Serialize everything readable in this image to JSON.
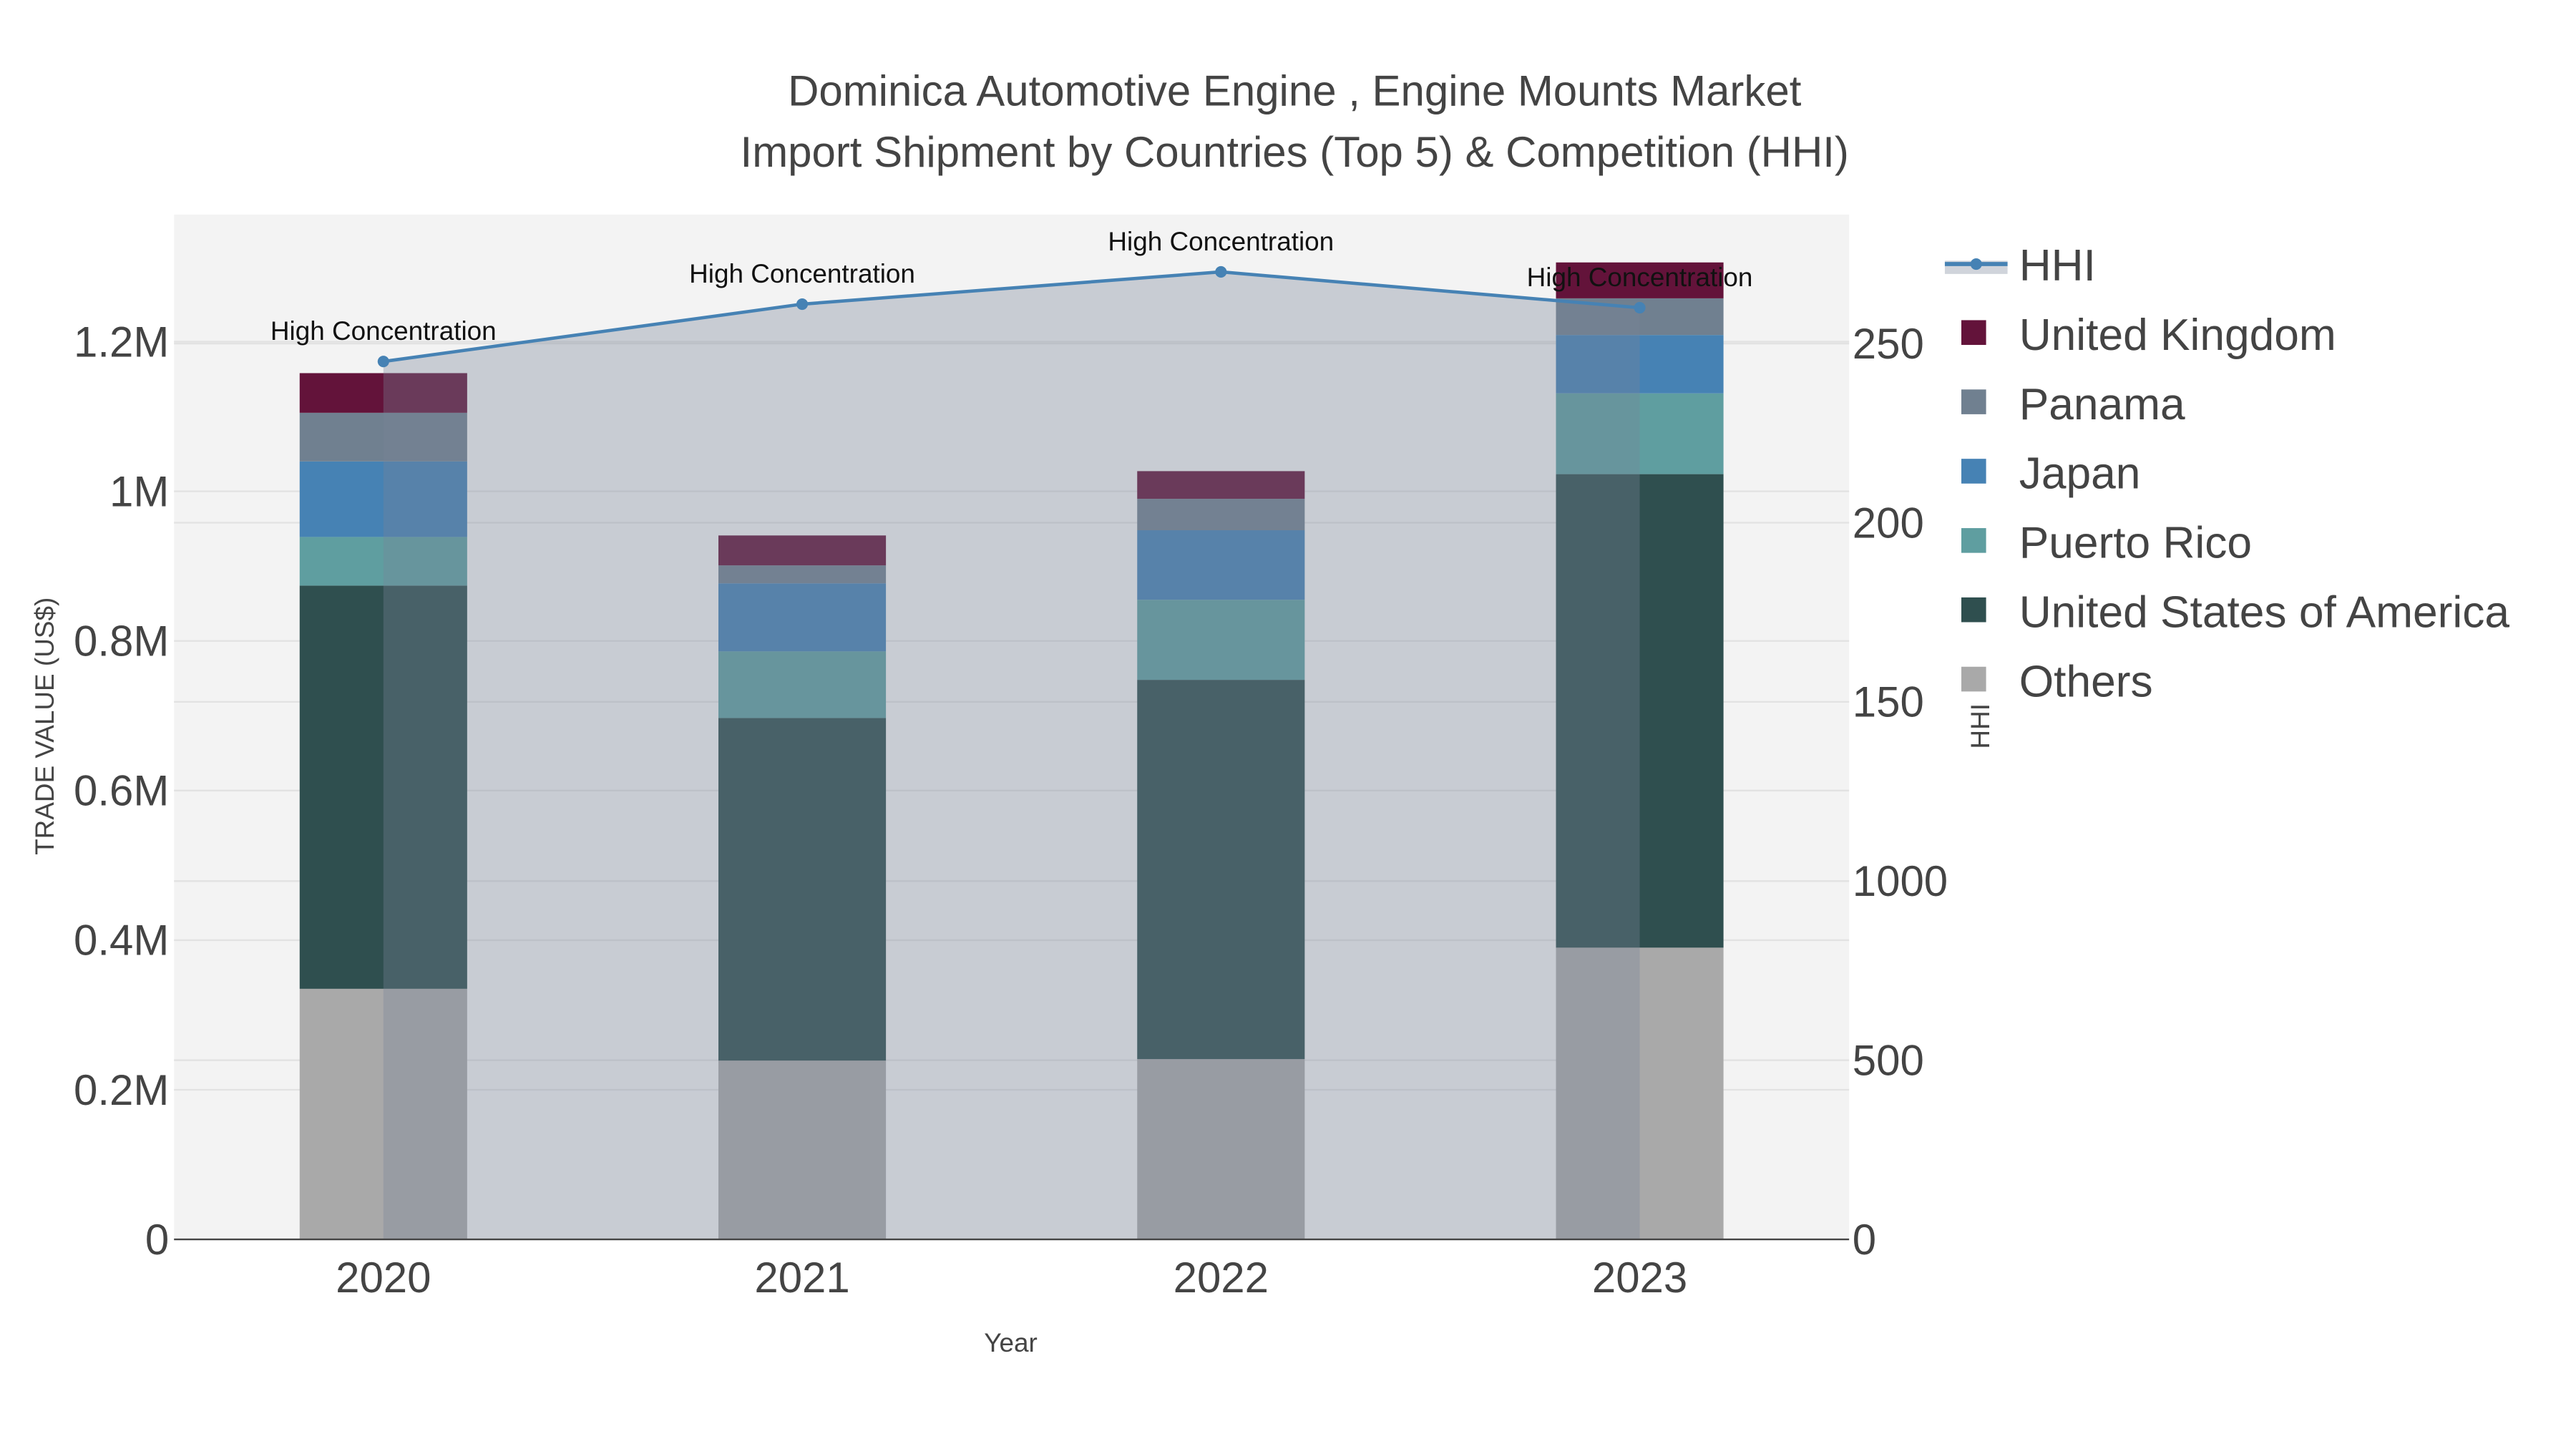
{
  "chart_data": {
    "type": "bar",
    "stacked": true,
    "title": "Dominica Automotive Engine , Engine Mounts Market",
    "subtitle": "Import Shipment by Countries (Top 5) & Competition (HHI)",
    "xlabel": "Year",
    "ylabel": "TRADE VALUE (US$)",
    "y2label": "HHI",
    "categories": [
      "2020",
      "2021",
      "2022",
      "2023"
    ],
    "ylim": [
      0,
      1.37
    ],
    "y_unit": "M US$",
    "y_ticks": [
      {
        "v": 0,
        "label": "0"
      },
      {
        "v": 0.2,
        "label": "0.2M"
      },
      {
        "v": 0.4,
        "label": "0.4M"
      },
      {
        "v": 0.6,
        "label": "0.6M"
      },
      {
        "v": 0.8,
        "label": "0.8M"
      },
      {
        "v": 1.0,
        "label": "1M"
      },
      {
        "v": 1.2,
        "label": "1.2M"
      }
    ],
    "y2lim": [
      0,
      286
    ],
    "y2_ticks": [
      {
        "v": 0,
        "label": "0"
      },
      {
        "v": 50,
        "label": "500"
      },
      {
        "v": 100,
        "label": "1000"
      },
      {
        "v": 150,
        "label": "150"
      },
      {
        "v": 200,
        "label": "200"
      },
      {
        "v": 250,
        "label": "250"
      }
    ],
    "series": [
      {
        "name": "Others",
        "color": "#a9a9a9",
        "values": [
          0.335,
          0.239,
          0.241,
          0.39
        ]
      },
      {
        "name": "United States of America",
        "color": "#2f4f4f",
        "values": [
          0.539,
          0.458,
          0.507,
          0.633
        ]
      },
      {
        "name": "Puerto Rico",
        "color": "#5f9ea0",
        "values": [
          0.065,
          0.089,
          0.107,
          0.108
        ]
      },
      {
        "name": "Japan",
        "color": "#4682b4",
        "values": [
          0.101,
          0.091,
          0.093,
          0.078
        ]
      },
      {
        "name": "Panama",
        "color": "#708090",
        "values": [
          0.065,
          0.024,
          0.042,
          0.049
        ]
      },
      {
        "name": "United Kingdom",
        "color": "#63133a",
        "values": [
          0.053,
          0.04,
          0.037,
          0.048
        ]
      }
    ],
    "line": {
      "name": "HHI",
      "color": "#4682b4",
      "fill": "rgba(119,133,153,0.35)",
      "values": [
        245,
        261,
        270,
        260
      ],
      "annotations": [
        "High Concentration",
        "High Concentration",
        "High Concentration",
        "High Concentration"
      ]
    },
    "legend": {
      "placement": "right",
      "order": [
        "HHI",
        "United Kingdom",
        "Panama",
        "Japan",
        "Puerto Rico",
        "United States of America",
        "Others"
      ]
    },
    "grid": true
  }
}
